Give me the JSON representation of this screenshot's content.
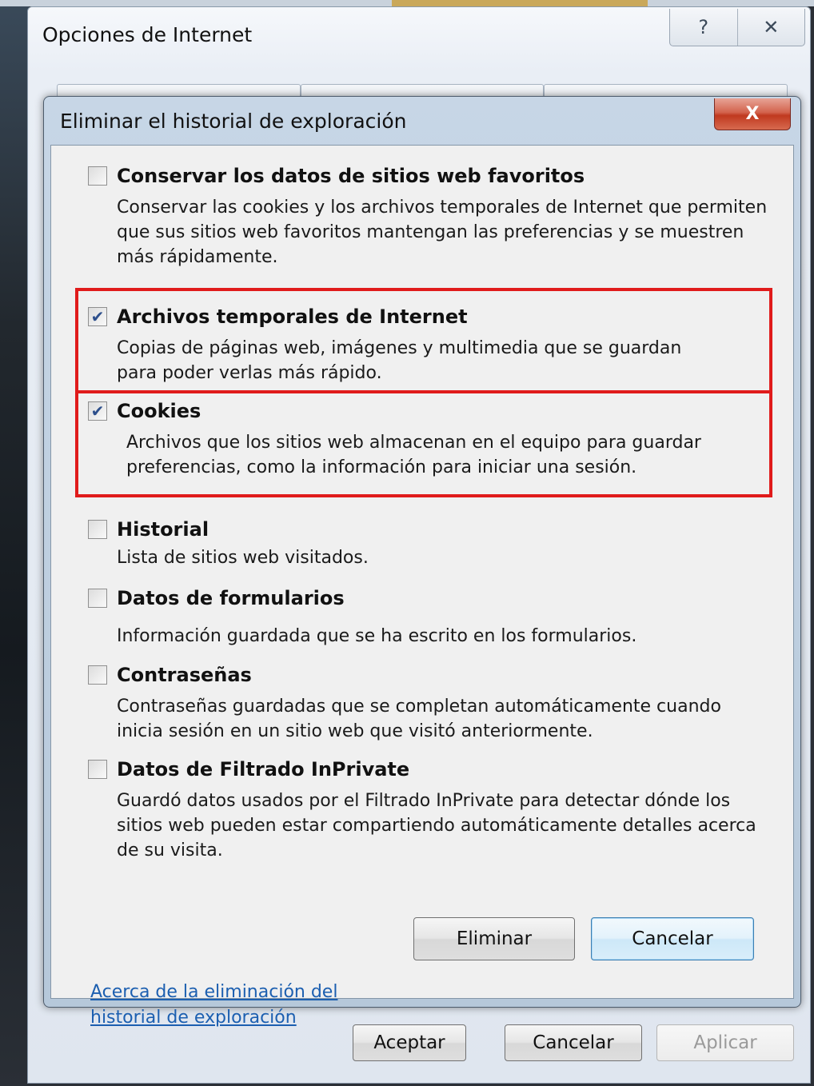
{
  "outer_dialog": {
    "title": "Opciones de Internet",
    "help_button": "?",
    "close_button": "✕",
    "buttons": {
      "ok": "Aceptar",
      "cancel": "Cancelar",
      "apply": "Aplicar"
    }
  },
  "modal": {
    "title": "Eliminar el historial de exploración",
    "close_button": "X",
    "options": [
      {
        "label": "Conservar los datos de sitios web favoritos",
        "checked": false,
        "description": "Conservar las cookies y los archivos temporales de Internet que permiten que sus sitios web favoritos mantengan las preferencias y se muestren más rápidamente."
      },
      {
        "label": "Archivos temporales de Internet",
        "checked": true,
        "description": "Copias de páginas web, imágenes y multimedia que se guardan para poder verlas más rápido."
      },
      {
        "label": "Cookies",
        "checked": true,
        "description": "Archivos que los sitios web almacenan en el equipo para guardar preferencias, como la información para iniciar una sesión."
      },
      {
        "label": "Historial",
        "checked": false,
        "description": "Lista de sitios web visitados."
      },
      {
        "label": "Datos de formularios",
        "checked": false,
        "description": "Información guardada que se ha escrito en los formularios."
      },
      {
        "label": "Contraseñas",
        "checked": false,
        "description": "Contraseñas guardadas que se completan automáticamente cuando inicia sesión en un sitio web que visitó anteriormente."
      },
      {
        "label": "Datos de Filtrado InPrivate",
        "checked": false,
        "description": "Guardó datos usados por el Filtrado InPrivate para detectar dónde los sitios web pueden estar compartiendo automáticamente detalles acerca de su visita."
      }
    ],
    "link": "Acerca de la eliminación del historial de exploración",
    "buttons": {
      "delete": "Eliminar",
      "cancel": "Cancelar"
    }
  },
  "colors": {
    "highlight": "#e01b1b",
    "link": "#1c5fb0",
    "checkmark": "#2d4f8c"
  }
}
